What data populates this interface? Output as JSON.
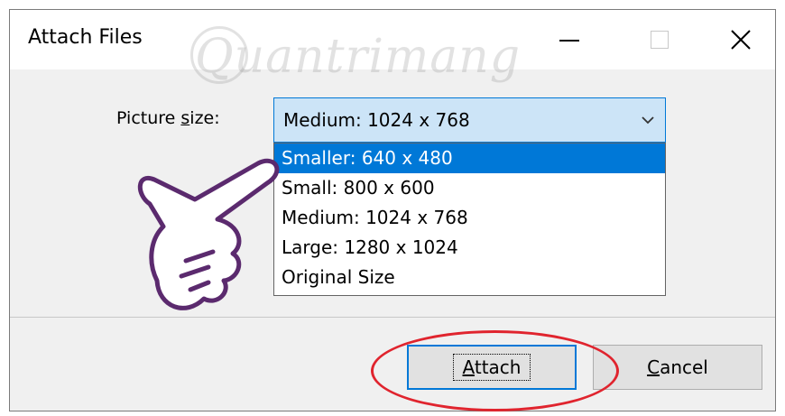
{
  "window": {
    "title": "Attach Files",
    "controls": {
      "minimize": "minimize-icon",
      "maximize": "maximize-icon",
      "close": "close-icon"
    }
  },
  "watermark": {
    "text": "Quantrimang"
  },
  "picture_size": {
    "label_prefix": "Picture ",
    "label_underlined": "s",
    "label_suffix": "ize:",
    "selected_value": "Medium: 1024 x 768",
    "options": [
      "Smaller: 640 x 480",
      "Small: 800 x 600",
      "Medium: 1024 x 768",
      "Large: 1280 x 1024",
      "Original Size"
    ],
    "highlighted_option": "Smaller: 640 x 480"
  },
  "buttons": {
    "attach_mnemonic": "A",
    "attach_rest": "ttach",
    "cancel_mnemonic": "C",
    "cancel_rest": "ancel"
  },
  "colors": {
    "accent": "#0078d7",
    "combo_bg": "#cce4f7",
    "annotation_red": "#e0242e",
    "hand_outline": "#5b2a6e"
  }
}
